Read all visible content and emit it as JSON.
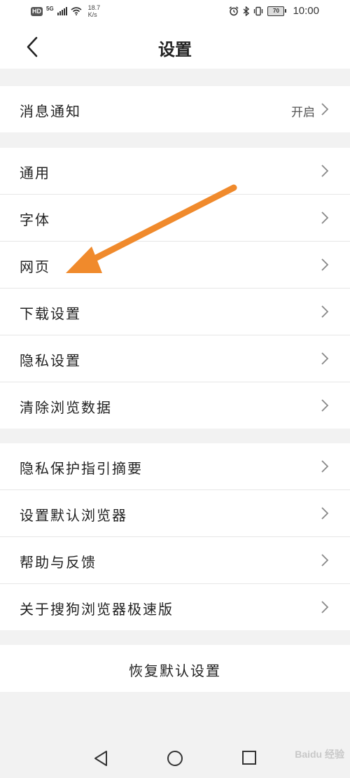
{
  "status_bar": {
    "hd": "HD",
    "network": "5G",
    "speed_value": "18.7",
    "speed_unit": "K/s",
    "battery": "70",
    "time": "10:00"
  },
  "header": {
    "title": "设置"
  },
  "groups": [
    {
      "items": [
        {
          "label": "消息通知",
          "value": "开启"
        }
      ]
    },
    {
      "items": [
        {
          "label": "通用"
        },
        {
          "label": "字体"
        },
        {
          "label": "网页"
        },
        {
          "label": "下载设置"
        },
        {
          "label": "隐私设置"
        },
        {
          "label": "清除浏览数据"
        }
      ]
    },
    {
      "items": [
        {
          "label": "隐私保护指引摘要"
        },
        {
          "label": "设置默认浏览器"
        },
        {
          "label": "帮助与反馈"
        },
        {
          "label": "关于搜狗浏览器极速版"
        }
      ]
    }
  ],
  "reset_label": "恢复默认设置",
  "annotation": {
    "type": "arrow",
    "color": "#f08a2c",
    "points_to": "网页"
  },
  "watermark": "Baidu 经验",
  "icons": [
    "back-arrow-icon",
    "chevron-right-icon",
    "nav-back-icon",
    "nav-home-icon",
    "nav-recents-icon"
  ]
}
